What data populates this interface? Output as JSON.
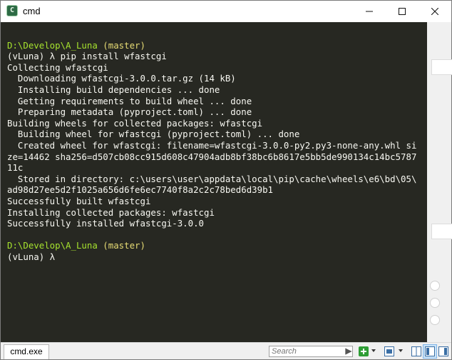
{
  "window": {
    "title": "cmd",
    "icon": "conemu-icon",
    "controls": {
      "minimize": "minimize-icon",
      "maximize": "maximize-icon",
      "close": "close-icon"
    }
  },
  "console": {
    "lines": [
      {
        "segments": []
      },
      {
        "segments": [
          {
            "text": "D:\\Develop\\A_Luna",
            "style": "prompt"
          },
          {
            "text": " (master)",
            "style": "branch"
          }
        ]
      },
      {
        "segments": [
          {
            "text": "(vLuna) λ pip install wfastcgi",
            "style": ""
          }
        ]
      },
      {
        "segments": [
          {
            "text": "Collecting wfastcgi",
            "style": ""
          }
        ]
      },
      {
        "segments": [
          {
            "text": "  Downloading wfastcgi-3.0.0.tar.gz (14 kB)",
            "style": ""
          }
        ]
      },
      {
        "segments": [
          {
            "text": "  Installing build dependencies ... done",
            "style": ""
          }
        ]
      },
      {
        "segments": [
          {
            "text": "  Getting requirements to build wheel ... done",
            "style": ""
          }
        ]
      },
      {
        "segments": [
          {
            "text": "  Preparing metadata (pyproject.toml) ... done",
            "style": ""
          }
        ]
      },
      {
        "segments": [
          {
            "text": "Building wheels for collected packages: wfastcgi",
            "style": ""
          }
        ]
      },
      {
        "segments": [
          {
            "text": "  Building wheel for wfastcgi (pyproject.toml) ... done",
            "style": ""
          }
        ]
      },
      {
        "segments": [
          {
            "text": "  Created wheel for wfastcgi: filename=wfastcgi-3.0.0-py2.py3-none-any.whl si",
            "style": ""
          }
        ]
      },
      {
        "segments": [
          {
            "text": "ze=14462 sha256=d507cb08cc915d608c47904adb8bf38bc6b8617e5bb5de990134c14bc5787",
            "style": ""
          }
        ]
      },
      {
        "segments": [
          {
            "text": "11c",
            "style": ""
          }
        ]
      },
      {
        "segments": [
          {
            "text": "  Stored in directory: c:\\users\\user\\appdata\\local\\pip\\cache\\wheels\\e6\\bd\\05\\",
            "style": ""
          }
        ]
      },
      {
        "segments": [
          {
            "text": "ad98d27ee5d2f1025a656d6fe6ec7740f8a2c2c78bed6d39b1",
            "style": ""
          }
        ]
      },
      {
        "segments": [
          {
            "text": "Successfully built wfastcgi",
            "style": ""
          }
        ]
      },
      {
        "segments": [
          {
            "text": "Installing collected packages: wfastcgi",
            "style": ""
          }
        ]
      },
      {
        "segments": [
          {
            "text": "Successfully installed wfastcgi-3.0.0",
            "style": ""
          }
        ]
      },
      {
        "segments": []
      },
      {
        "segments": [
          {
            "text": "D:\\Develop\\A_Luna",
            "style": "prompt"
          },
          {
            "text": " (master)",
            "style": "branch"
          }
        ]
      },
      {
        "segments": [
          {
            "text": "(vLuna) λ ",
            "style": ""
          }
        ]
      }
    ]
  },
  "colors": {
    "background": "#272822",
    "foreground": "#f8f8f2",
    "prompt": "#a6e22e",
    "branch": "#e6db74"
  },
  "statusbar": {
    "tab_label": "cmd.exe",
    "search_placeholder": "Search",
    "icons": [
      "search-icon",
      "add-console-icon",
      "dropdown-icon",
      "console-layout-icon",
      "dropdown-icon",
      "split-view-icon",
      "panel-icon"
    ]
  }
}
